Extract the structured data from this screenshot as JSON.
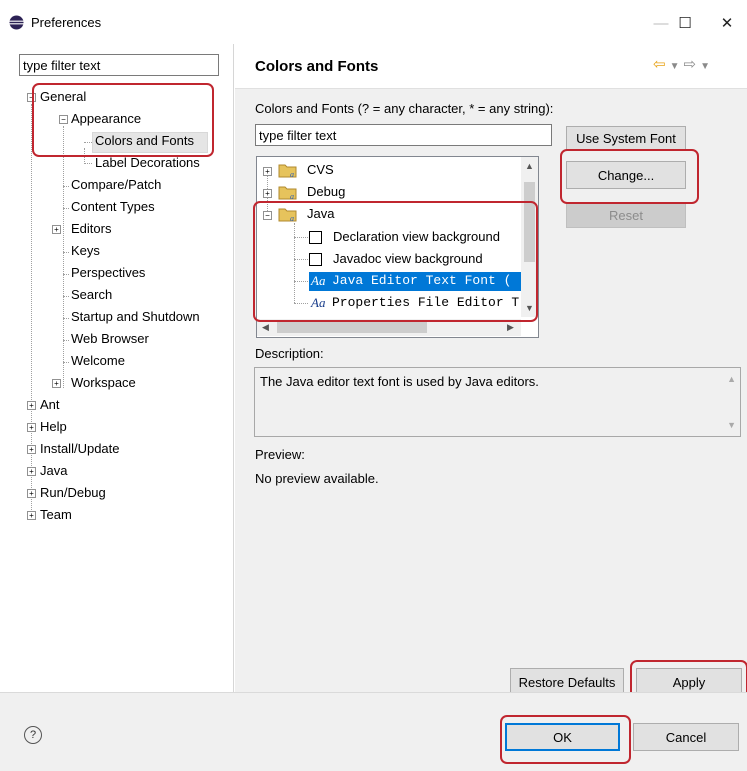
{
  "window": {
    "title": "Preferences",
    "minimize": "—",
    "maximize": "☐",
    "close": "✕"
  },
  "left": {
    "filter_value": "type filter text",
    "tree": {
      "general": "General",
      "appearance": "Appearance",
      "colors_fonts": "Colors and Fonts",
      "label_decorations": "Label Decorations",
      "compare_patch": "Compare/Patch",
      "content_types": "Content Types",
      "editors": "Editors",
      "keys": "Keys",
      "perspectives": "Perspectives",
      "search": "Search",
      "startup_shutdown": "Startup and Shutdown",
      "web_browser": "Web Browser",
      "welcome": "Welcome",
      "workspace": "Workspace",
      "ant": "Ant",
      "help": "Help",
      "install_update": "Install/Update",
      "java": "Java",
      "run_debug": "Run/Debug",
      "team": "Team"
    }
  },
  "right": {
    "title": "Colors and Fonts",
    "filter_caption": "Colors and Fonts (? = any character, * = any string):",
    "filter_value": "type filter text",
    "use_system_font": "Use System Font",
    "change": "Change...",
    "reset": "Reset",
    "tree": {
      "cvs": "CVS",
      "debug": "Debug",
      "java": "Java",
      "decl_bg": "Declaration view background",
      "javadoc_bg": "Javadoc view background",
      "java_editor_font": "Java Editor Text Font (",
      "properties_font": "Properties File Editor T"
    },
    "font_glyph": "Aa",
    "description_label": "Description:",
    "description_text": "The Java editor text font is used by Java editors.",
    "preview_label": "Preview:",
    "preview_text": "No preview available.",
    "restore_defaults": "Restore Defaults",
    "apply": "Apply"
  },
  "footer": {
    "help_icon": "?",
    "ok": "OK",
    "cancel": "Cancel"
  },
  "colors": {
    "selection": "#0078d7",
    "highlight": "#c0262f"
  }
}
